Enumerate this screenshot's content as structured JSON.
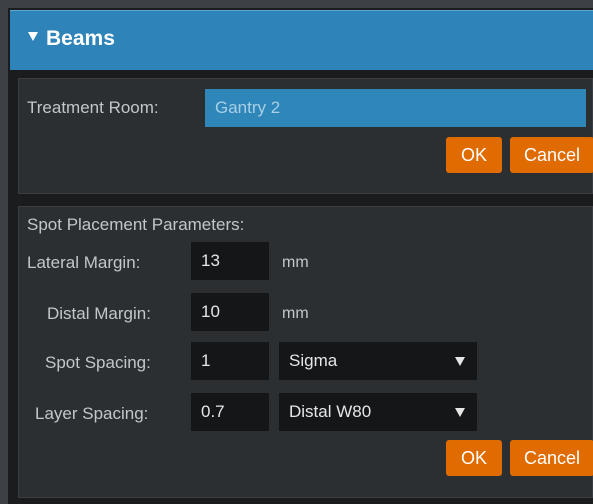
{
  "header": {
    "title": "Beams"
  },
  "room": {
    "label": "Treatment Room:",
    "value": "Gantry 2",
    "ok_label": "OK",
    "cancel_label": "Cancel"
  },
  "spot": {
    "section_title": "Spot Placement Parameters:",
    "lateral_margin": {
      "label": "Lateral Margin:",
      "value": "13",
      "unit": "mm"
    },
    "distal_margin": {
      "label": "Distal Margin:",
      "value": "10",
      "unit": "mm"
    },
    "spot_spacing": {
      "label": "Spot Spacing:",
      "value": "1",
      "mode": "Sigma"
    },
    "layer_spacing": {
      "label": "Layer Spacing:",
      "value": "0.7",
      "mode": "Distal W80"
    },
    "ok_label": "OK",
    "cancel_label": "Cancel"
  },
  "colors": {
    "header_blue": "#2e84b8",
    "button_orange": "#e06b00",
    "panel_bg": "#2b2f32",
    "field_bg": "#141618"
  },
  "icons": {
    "header": "caret-down-icon",
    "dropdown": "caret-down-icon"
  }
}
